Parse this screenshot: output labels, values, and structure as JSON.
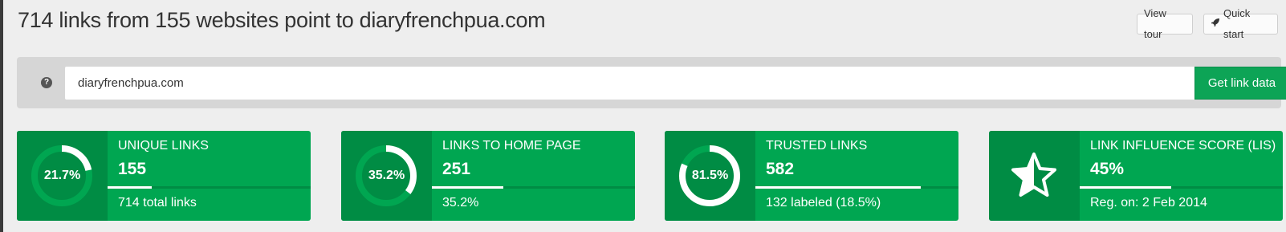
{
  "header": {
    "title": "714 links from 155 websites point to diaryfrenchpua.com",
    "view_tour_label": "View tour",
    "quick_start_label": "Quick start"
  },
  "search": {
    "value": "diaryfrenchpua.com",
    "button_label": "Get link data"
  },
  "cards": [
    {
      "title": "UNIQUE LINKS",
      "value": "155",
      "percent_label": "21.7%",
      "ring_fraction": 0.217,
      "bar_fraction": 0.217,
      "sub": "714 total links"
    },
    {
      "title": "LINKS TO HOME PAGE",
      "value": "251",
      "percent_label": "35.2%",
      "ring_fraction": 0.352,
      "bar_fraction": 0.352,
      "sub": "35.2%"
    },
    {
      "title": "TRUSTED LINKS",
      "value": "582",
      "percent_label": "81.5%",
      "ring_fraction": 0.815,
      "bar_fraction": 0.815,
      "sub": "132 labeled (18.5%)"
    },
    {
      "title": "LINK INFLUENCE SCORE (LIS)",
      "value": "45%",
      "icon": "half-star-icon",
      "bar_fraction": 0.45,
      "sub": "Reg. on: 2 Feb 2014"
    }
  ],
  "colors": {
    "card_green": "#00a651",
    "card_dark_green": "#008c44",
    "button_green": "#0da456"
  }
}
